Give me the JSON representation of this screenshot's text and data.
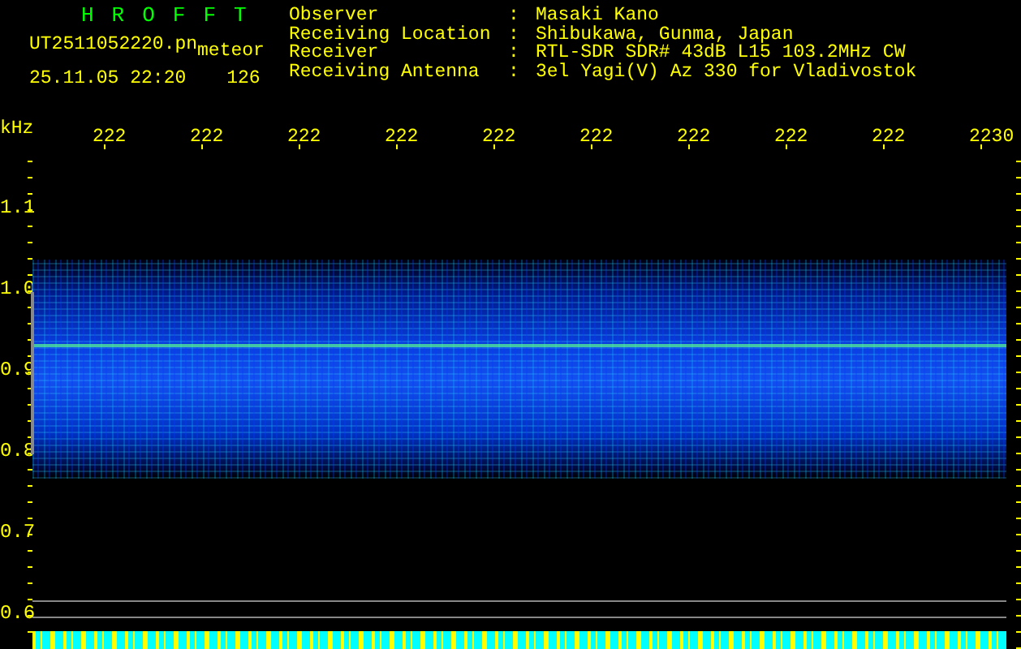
{
  "app": {
    "title": "HROFFT"
  },
  "file": {
    "name": "UT2511052220.pn",
    "mode": "meteor",
    "datetime": "25.11.05 22:20",
    "count": "126"
  },
  "info": [
    {
      "label": "Observer",
      "separator": ":",
      "value": "Masaki Kano"
    },
    {
      "label": "Receiving Location",
      "separator": ":",
      "value": "Shibukawa, Gunma, Japan"
    },
    {
      "label": "Receiver",
      "separator": ":",
      "value": "RTL-SDR SDR# 43dB L15 103.2MHz CW"
    },
    {
      "label": "Receiving Antenna",
      "separator": ":",
      "value": "3el Yagi(V) Az 330 for Vladivostok"
    }
  ],
  "plot": {
    "y_unit": "kHz",
    "y_labels": [
      "1.1",
      "1.0",
      "0.9",
      "0.8",
      "0.7",
      "0.6"
    ],
    "time_labels": [
      "222",
      "222",
      "222",
      "222",
      "222",
      "222",
      "222",
      "222",
      "222",
      "2230"
    ]
  }
}
